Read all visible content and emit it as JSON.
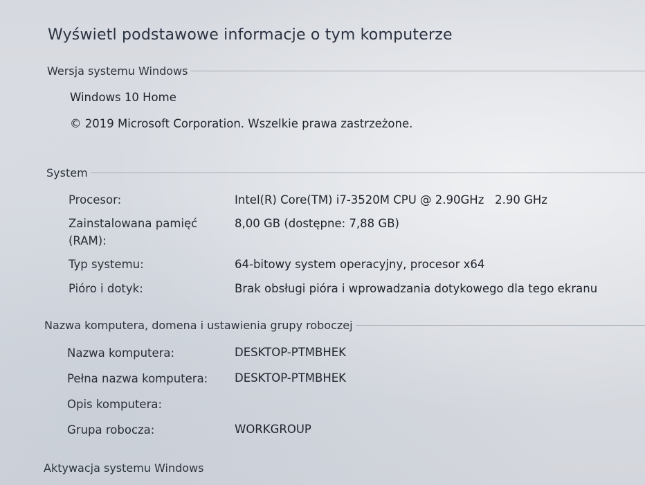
{
  "page_title": "Wyświetl podstawowe informacje o tym komputerze",
  "edition": {
    "header": "Wersja systemu Windows",
    "name": "Windows 10 Home",
    "copyright": "© 2019 Microsoft Corporation. Wszelkie prawa zastrzeżone."
  },
  "system": {
    "header": "System",
    "rows": [
      {
        "label": "Procesor:",
        "value": "Intel(R) Core(TM) i7-3520M CPU @ 2.90GHz   2.90 GHz"
      },
      {
        "label_line1": "Zainstalowana pamięć",
        "label_line2": "(RAM):",
        "value": "8,00 GB (dostępne: 7,88 GB)"
      },
      {
        "label": "Typ systemu:",
        "value": "64-bitowy system operacyjny, procesor x64"
      },
      {
        "label": "Pióro i dotyk:",
        "value": "Brak obsługi pióra i wprowadzania dotykowego dla tego ekranu"
      }
    ]
  },
  "computer": {
    "header": "Nazwa komputera, domena i ustawienia grupy roboczej",
    "rows": [
      {
        "label": "Nazwa komputera:",
        "value": "DESKTOP-PTMBHEK"
      },
      {
        "label": "Pełna nazwa komputera:",
        "value": "DESKTOP-PTMBHEK"
      },
      {
        "label": "Opis komputera:",
        "value": ""
      },
      {
        "label": "Grupa robocza:",
        "value": "WORKGROUP"
      }
    ]
  },
  "activation": {
    "header": "Aktywacja systemu Windows"
  }
}
